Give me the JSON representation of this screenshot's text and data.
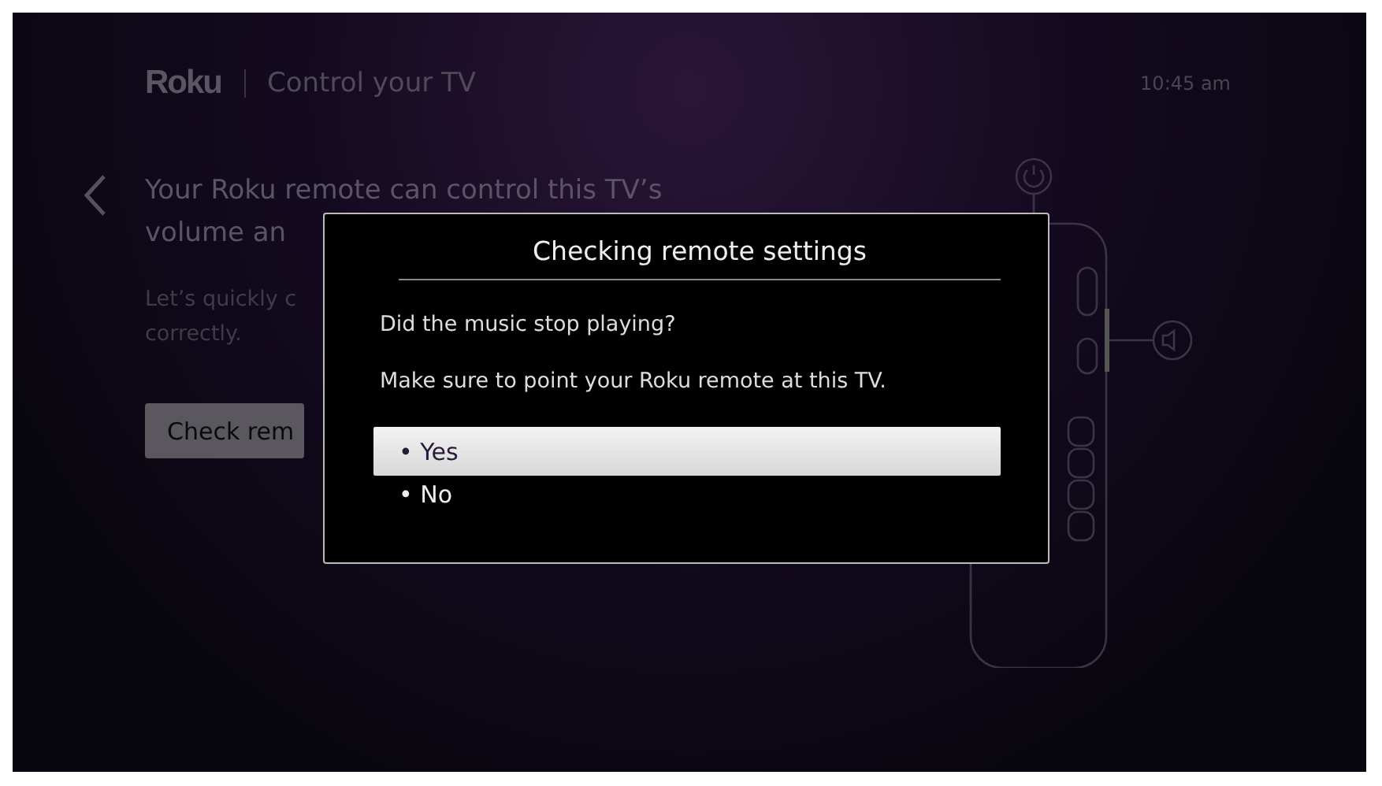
{
  "header": {
    "logo": "Roku",
    "title": "Control your TV",
    "time": "10:45 am"
  },
  "content": {
    "heading_lines": [
      "Your Roku remote can control this TV’s",
      "volume an"
    ],
    "body_lines": [
      "Let’s quickly c",
      "correctly."
    ],
    "button": "Check rem"
  },
  "dialog": {
    "title": "Checking remote settings",
    "question": "Did the music stop playing?",
    "hint": "Make sure to point your Roku remote at this TV.",
    "options": [
      {
        "bullet": "•",
        "label": "Yes",
        "selected": true
      },
      {
        "bullet": "•",
        "label": "No",
        "selected": false
      }
    ]
  }
}
